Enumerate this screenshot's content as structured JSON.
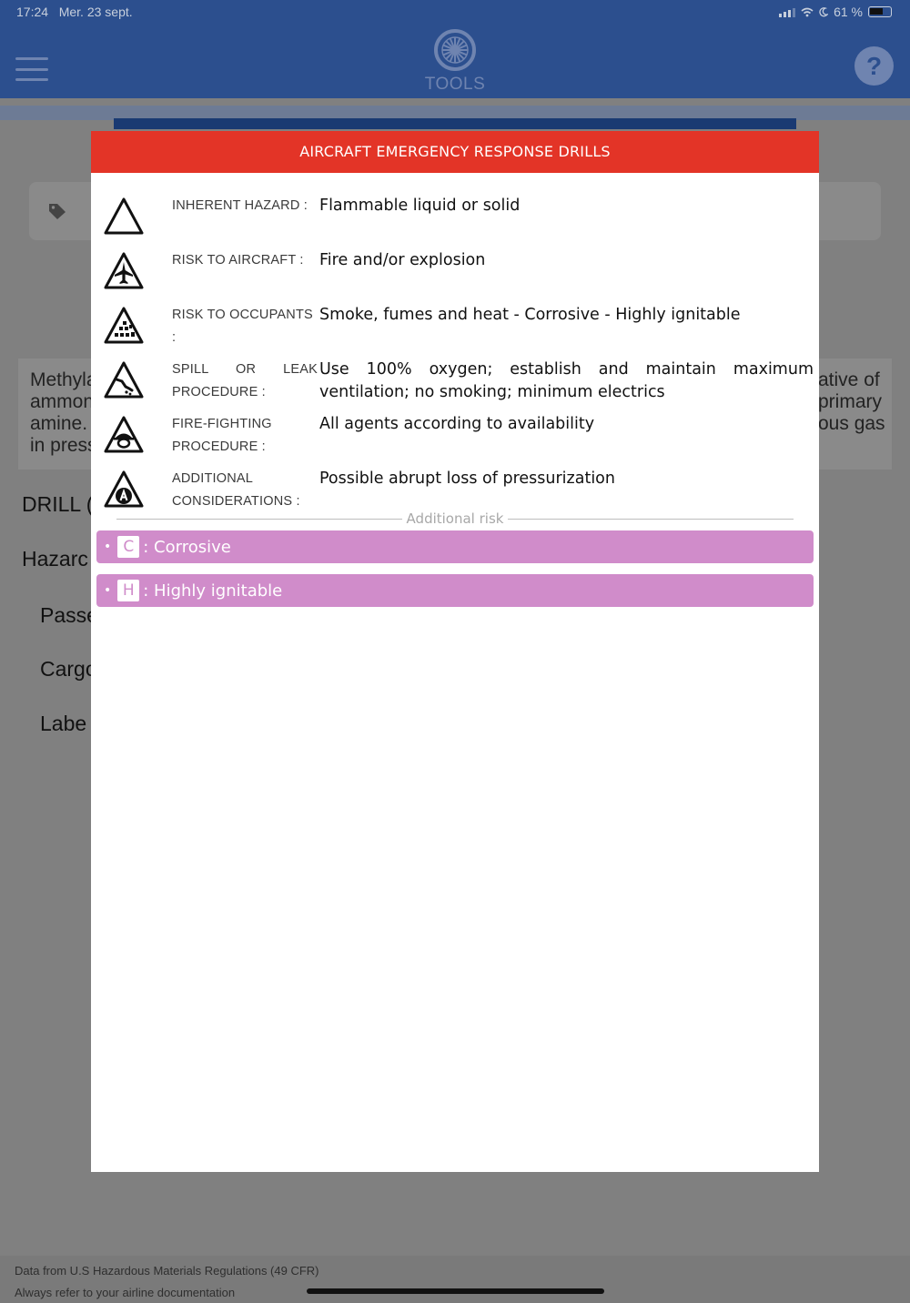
{
  "status_bar": {
    "time": "17:24",
    "date": "Mer. 23 sept.",
    "battery": "61 %"
  },
  "header": {
    "title": "TOOLS",
    "logo_icon": "turbine-icon",
    "menu_icon": "hamburger-menu-icon",
    "help_label": "?"
  },
  "background": {
    "tag_icon": "tag-icon",
    "description_left": [
      "Methyla",
      "ammon",
      "amine.",
      "in press"
    ],
    "description_right": [
      "ative of",
      "primary",
      "ous gas"
    ],
    "headings": [
      "DRILL (",
      "Hazarc"
    ],
    "subheadings": [
      "Passe",
      "Cargo",
      "Labe"
    ]
  },
  "modal": {
    "title": "AIRCRAFT EMERGENCY RESPONSE DRILLS",
    "rows": [
      {
        "label": "INHERENT HAZARD :",
        "value": "Flammable liquid or solid",
        "icon": "hazard-triangle-icon"
      },
      {
        "label": "RISK TO AIRCRAFT :",
        "value": "Fire and/or explosion",
        "icon": "aircraft-triangle-icon"
      },
      {
        "label": "RISK TO OCCUPANTS :",
        "value": "Smoke, fumes and heat - Corrosive - Highly ignitable",
        "icon": "occupants-triangle-icon"
      },
      {
        "label": "SPILL OR LEAK PROCEDURE :",
        "value": "Use 100% oxygen; establish and maintain maximum ventilation; no smoking; minimum electrics",
        "icon": "spill-triangle-icon"
      },
      {
        "label": "FIRE-FIGHTING PROCEDURE :",
        "value": "All agents according to availability",
        "icon": "firefighter-triangle-icon"
      },
      {
        "label": "ADDITIONAL CONSIDERATIONS :",
        "value": "Possible abrupt loss of pressurization",
        "icon": "additional-a-triangle-icon"
      }
    ],
    "additional_risk_title": "Additional risk",
    "additional_risks": [
      {
        "code": "C",
        "label": ": Corrosive"
      },
      {
        "code": "H",
        "label": ": Highly ignitable"
      }
    ],
    "pill_color": "#d08cca",
    "header_color": "#e33427"
  },
  "footer": {
    "line1": "Data from U.S Hazardous Materials Regulations (49 CFR)",
    "line2": "Always refer to your airline documentation"
  },
  "colors": {
    "topbar": "#2c4f8e",
    "overlay": "#808080"
  }
}
